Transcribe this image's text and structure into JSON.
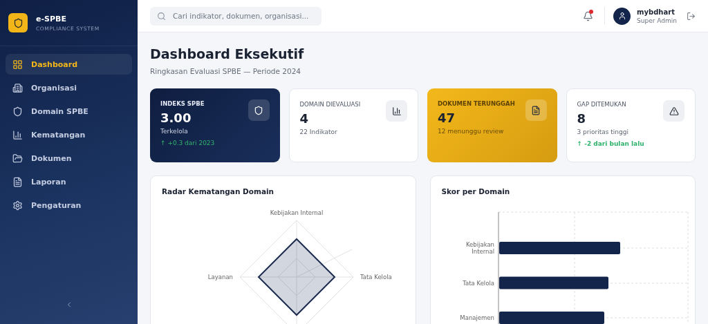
{
  "brand": {
    "name": "e-SPBE",
    "tagline": "COMPLIANCE SYSTEM"
  },
  "nav": [
    {
      "label": "Dashboard",
      "selected": true
    },
    {
      "label": "Organisasi",
      "selected": false
    },
    {
      "label": "Domain SPBE",
      "selected": false
    },
    {
      "label": "Kematangan",
      "selected": false
    },
    {
      "label": "Dokumen",
      "selected": false
    },
    {
      "label": "Laporan",
      "selected": false
    },
    {
      "label": "Pengaturan",
      "selected": false
    }
  ],
  "search": {
    "placeholder": "Cari indikator, dokumen, organisasi..."
  },
  "notifications": {
    "unread": true
  },
  "user": {
    "name": "mybdhart",
    "role": "Super Admin"
  },
  "page": {
    "title": "Dashboard Eksekutif",
    "subtitle": "Ringkasan Evaluasi SPBE — Periode 2024"
  },
  "cards": [
    {
      "kind": "dark",
      "label": "INDEKS SPBE",
      "value": "3.00",
      "note": "Terkelola",
      "trend": "↑ +0.3 dari 2023"
    },
    {
      "kind": "light",
      "label": "DOMAIN DIEVALUASI",
      "value": "4",
      "note": "22 Indikator"
    },
    {
      "kind": "gold",
      "label": "DOKUMEN TERUNGGAH",
      "value": "47",
      "note": "12 menunggu review"
    },
    {
      "kind": "light",
      "label": "GAP DITEMUKAN",
      "value": "8",
      "note": "3 prioritas tinggi",
      "trend": "↑ -2 dari bulan lalu"
    }
  ],
  "radar": {
    "title": "Radar Kematangan Domain",
    "axes": [
      "Kebijakan Internal",
      "Tata Kelola",
      "Layanan"
    ]
  },
  "bars": {
    "title": "Skor per Domain",
    "categories": [
      "Kebijakan Internal",
      "Tata Kelola",
      "Manajemen"
    ]
  }
}
